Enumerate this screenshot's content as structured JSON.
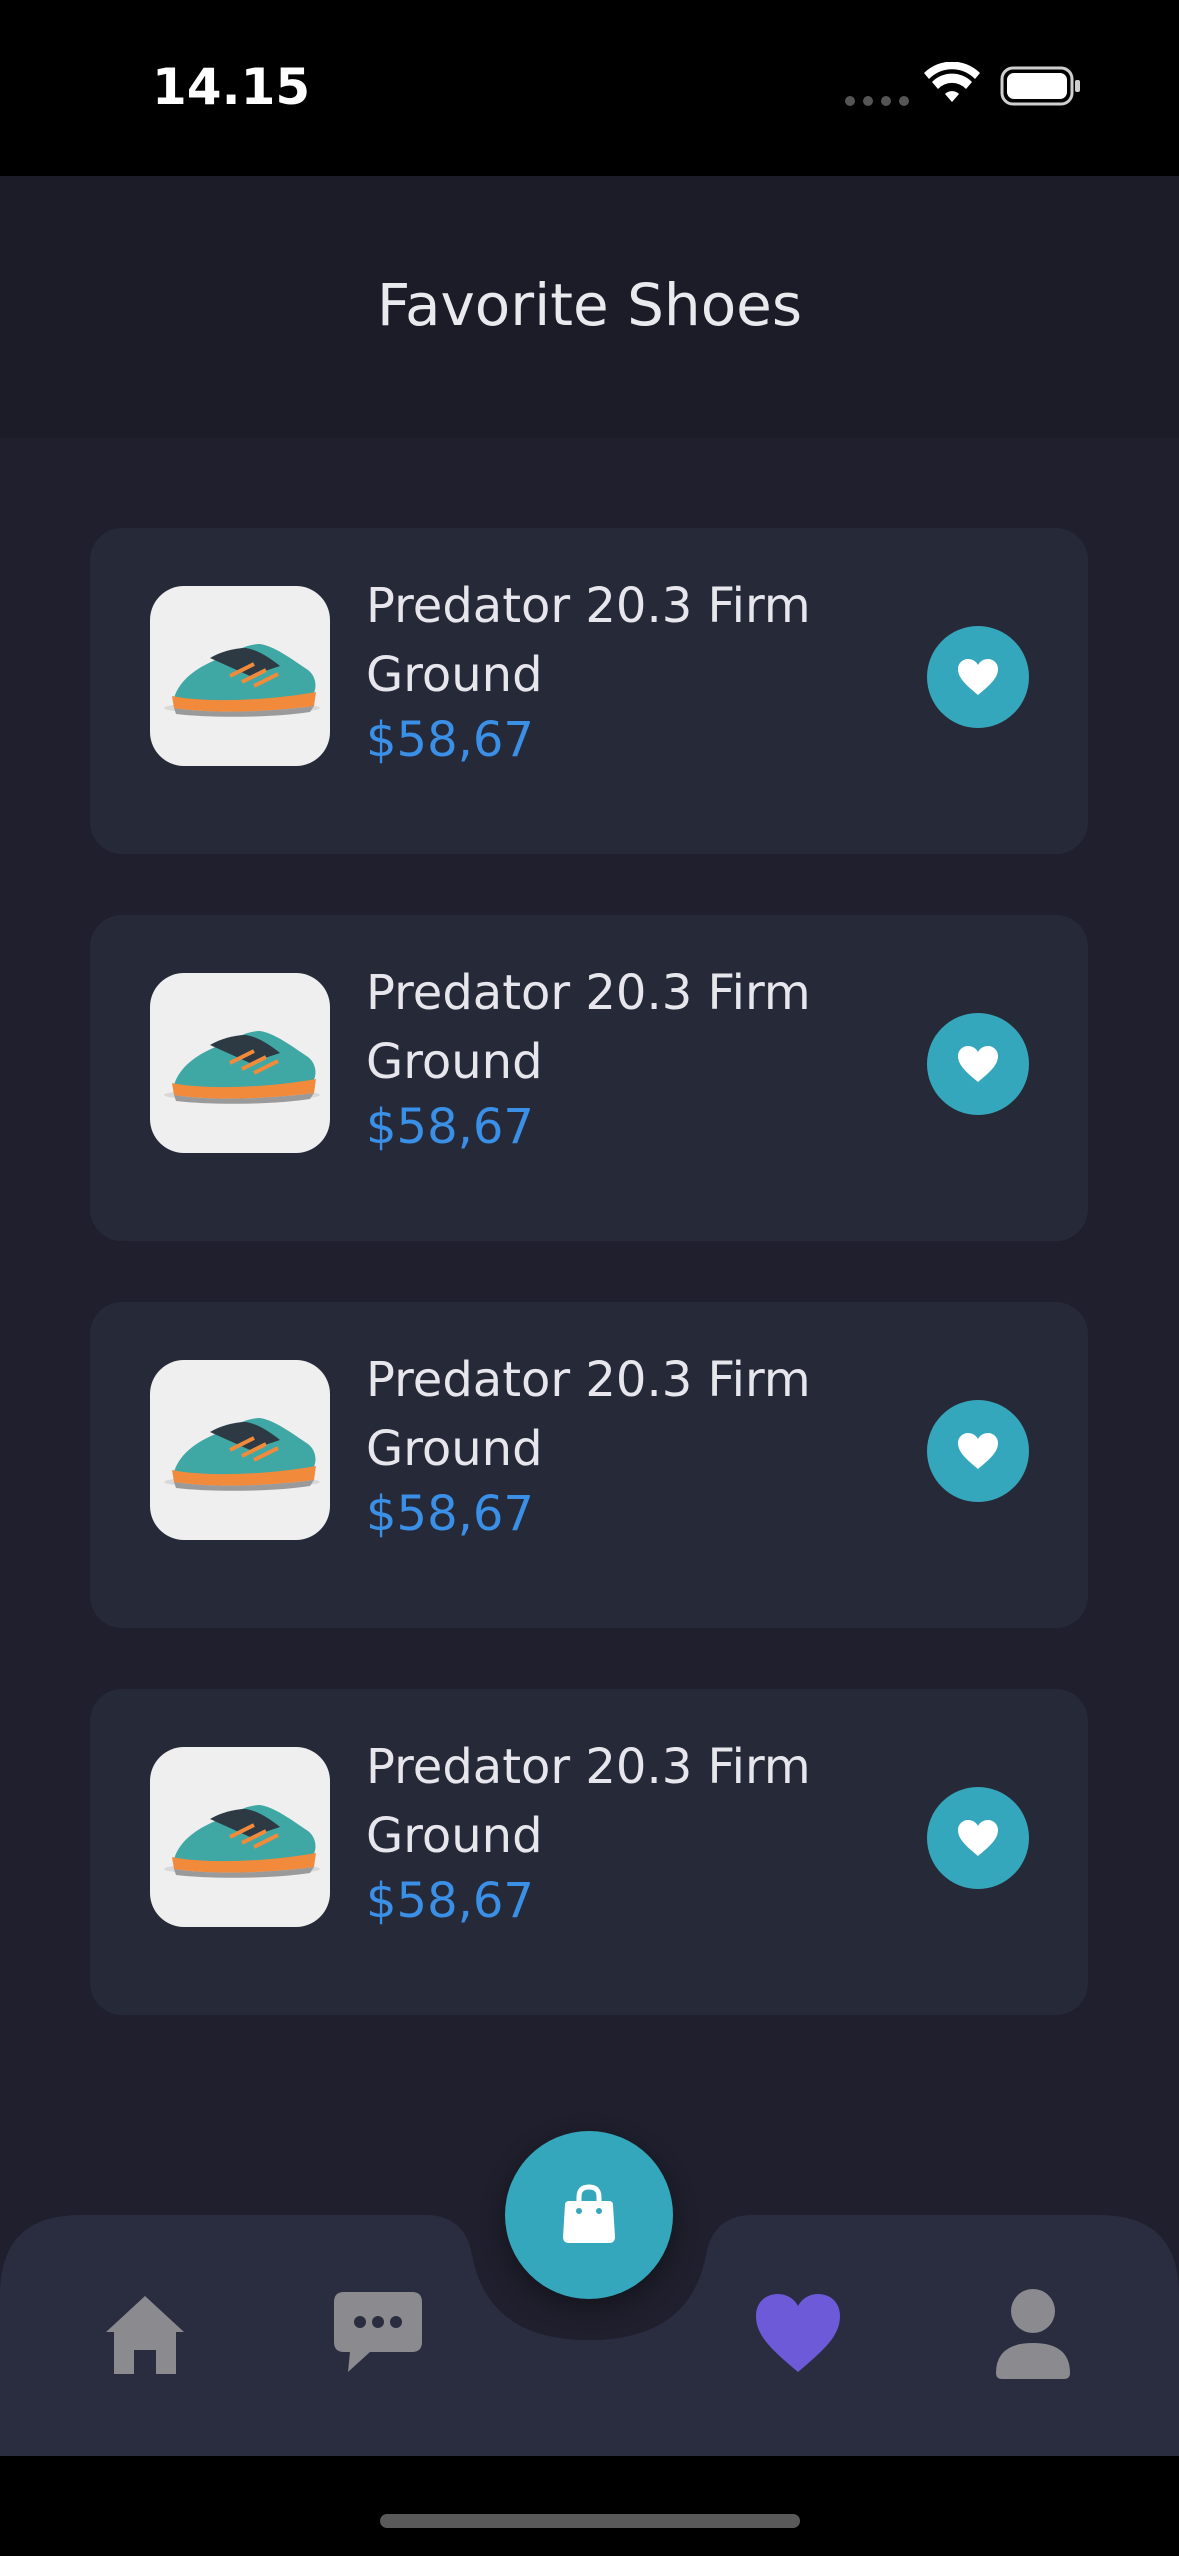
{
  "status_bar": {
    "time": "14.15",
    "icons": [
      "signal-dots-icon",
      "wifi-icon",
      "battery-icon"
    ]
  },
  "header": {
    "title": "Favorite Shoes"
  },
  "favorites": [
    {
      "name": "Predator 20.3 Firm Ground",
      "price": "$58,67",
      "image_icon": "shoe-icon",
      "action_icon": "heart-icon"
    },
    {
      "name": "Predator 20.3 Firm Ground",
      "price": "$58,67",
      "image_icon": "shoe-icon",
      "action_icon": "heart-icon"
    },
    {
      "name": "Predator 20.3 Firm Ground",
      "price": "$58,67",
      "image_icon": "shoe-icon",
      "action_icon": "heart-icon"
    },
    {
      "name": "Predator 20.3 Firm Ground",
      "price": "$58,67",
      "image_icon": "shoe-icon",
      "action_icon": "heart-icon"
    }
  ],
  "bottom_nav": {
    "items": [
      {
        "icon": "home-icon",
        "active": false
      },
      {
        "icon": "chat-icon",
        "active": false
      },
      {
        "icon": "heart-icon",
        "active": true
      },
      {
        "icon": "profile-icon",
        "active": false
      }
    ],
    "center_button_icon": "shopping-bag-icon"
  },
  "colors": {
    "background": "#1f1f2d",
    "header": "#1c1c29",
    "card": "#262938",
    "accent_teal": "#35a7bd",
    "price_blue": "#3a8fe6",
    "nav_active": "#6c5ad9",
    "nav_inactive": "#8a8a8f"
  }
}
